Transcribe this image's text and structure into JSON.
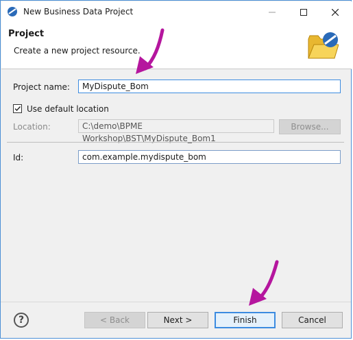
{
  "window": {
    "title": "New Business Data Project"
  },
  "header": {
    "title": "Project",
    "description": "Create a new project resource."
  },
  "form": {
    "project_name_label": "Project name:",
    "project_name_value": "MyDispute_Bom",
    "use_default_location_label": "Use default location",
    "use_default_location_checked": true,
    "location_label": "Location:",
    "location_value": "C:\\demo\\BPME Workshop\\BST\\MyDispute_Bom1",
    "browse_label": "Browse...",
    "id_label": "Id:",
    "id_value": "com.example.mydispute_bom"
  },
  "footer": {
    "help_label": "?",
    "back_label": "< Back",
    "next_label": "Next >",
    "finish_label": "Finish",
    "cancel_label": "Cancel"
  },
  "colors": {
    "accent": "#3b8be0",
    "annotation_arrow": "#b5169e"
  }
}
